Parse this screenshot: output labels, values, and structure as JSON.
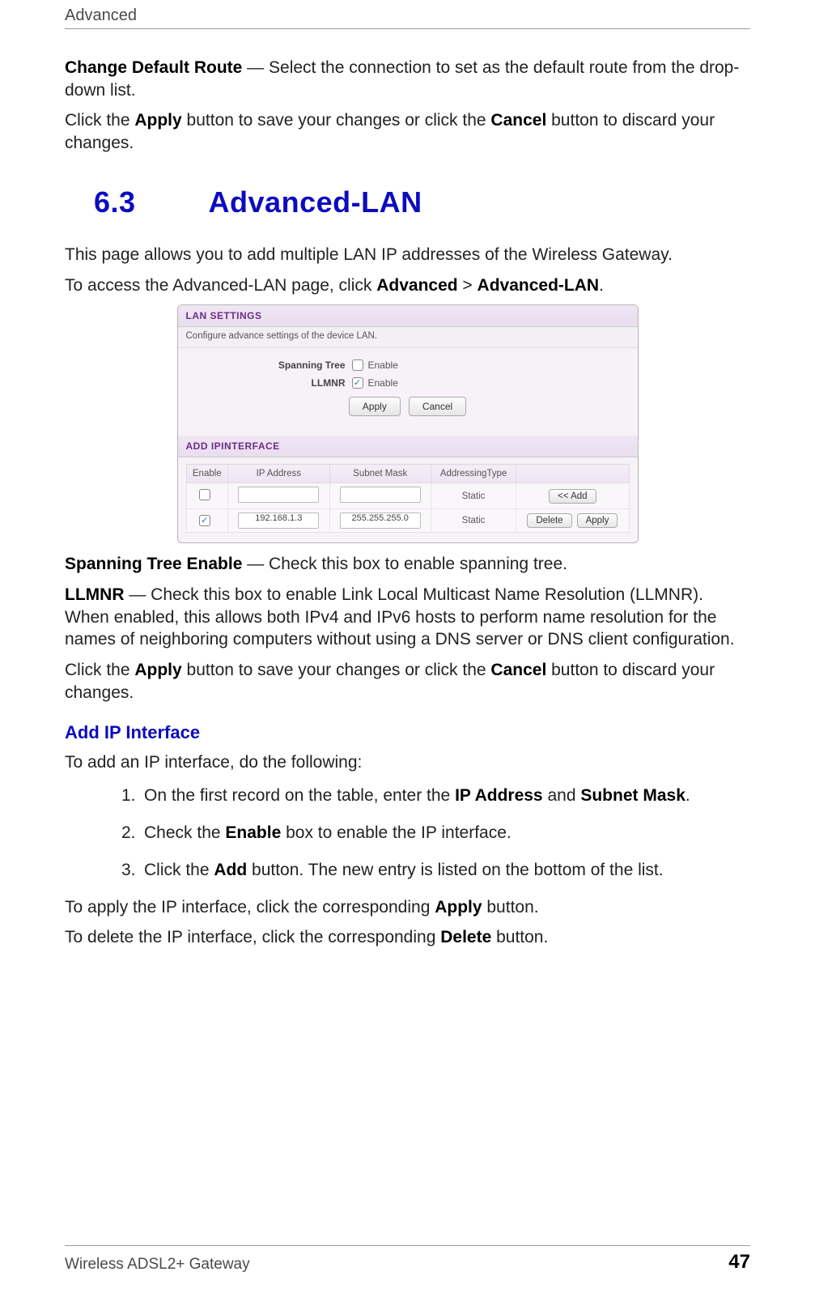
{
  "page": {
    "running_header": "Advanced",
    "footer_left": "Wireless ADSL2+ Gateway",
    "footer_right": "47"
  },
  "paras": {
    "change_default_route_term": "Change Default Route",
    "change_default_route_rest": " — Select the connection to set as the default route from the drop-down list.",
    "apply_cancel_1a": "Click the ",
    "apply_cancel_1b": "Apply",
    "apply_cancel_1c": " button to save your changes or click the ",
    "apply_cancel_1d": "Cancel",
    "apply_cancel_1e": " button to discard your changes.",
    "intro": "This page allows you to add multiple LAN IP addresses of the Wireless Gateway.",
    "access_a": "To access the Advanced-LAN page, click ",
    "access_b": "Advanced",
    "access_c": " > ",
    "access_d": "Advanced-LAN",
    "access_e": ".",
    "spanning_term": "Spanning Tree Enable",
    "spanning_rest": " — Check this box to enable spanning tree.",
    "llmnr_term": "LLMNR",
    "llmnr_rest": " — Check this box to enable Link Local Multicast Name Resolution (LLMNR). When enabled, this allows both IPv4 and IPv6 hosts to perform name resolution for the names of neighboring computers without using a DNS server or DNS client configuration.",
    "addip_intro": "To add an IP interface, do the following:",
    "apply_if_a": "To apply the IP interface, click the corresponding ",
    "apply_if_b": "Apply",
    "apply_if_c": " button.",
    "delete_if_a": "To delete the IP interface, click the corresponding ",
    "delete_if_b": "Delete",
    "delete_if_c": " button."
  },
  "headings": {
    "h2_num": "6.3",
    "h2_title": "Advanced-LAN",
    "h3_addip": "Add IP Interface"
  },
  "steps": {
    "s1a": "On the first record on the table, enter the ",
    "s1b": "IP Address",
    "s1c": " and ",
    "s1d": "Subnet Mask",
    "s1e": ".",
    "s2a": "Check the ",
    "s2b": "Enable",
    "s2c": " box to enable the IP interface.",
    "s3a": "Click the ",
    "s3b": "Add",
    "s3c": " button. The new entry is listed on the bottom of the list.",
    "n1": "1.",
    "n2": "2.",
    "n3": "3."
  },
  "shot": {
    "lan_settings_title": "LAN SETTINGS",
    "lan_settings_sub": "Configure advance settings of the device LAN.",
    "spanning_label": "Spanning Tree",
    "llmnr_label": "LLMNR",
    "enable_text": "Enable",
    "apply_btn": "Apply",
    "cancel_btn": "Cancel",
    "add_ip_title": "ADD IPINTERFACE",
    "cols": {
      "enable": "Enable",
      "ip": "IP Address",
      "mask": "Subnet Mask",
      "type": "AddressingType"
    },
    "rows": [
      {
        "enabled": false,
        "ip": "",
        "mask": "",
        "type": "Static",
        "actions": [
          "<< Add"
        ]
      },
      {
        "enabled": true,
        "ip": "192.168.1.3",
        "mask": "255.255.255.0",
        "type": "Static",
        "actions": [
          "Delete",
          "Apply"
        ]
      }
    ]
  }
}
